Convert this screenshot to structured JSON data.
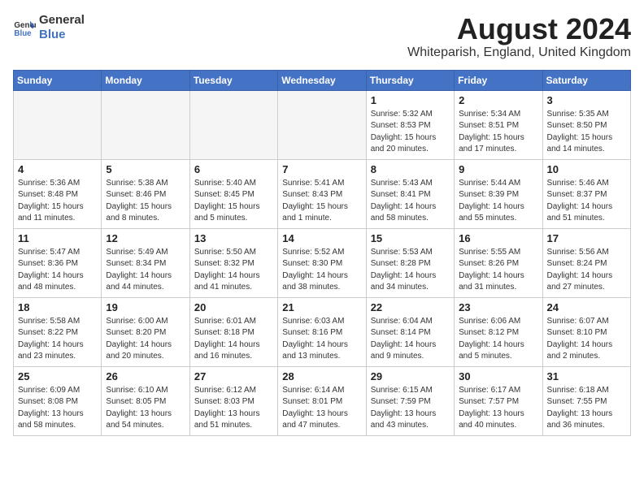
{
  "header": {
    "logo_line1": "General",
    "logo_line2": "Blue",
    "month_year": "August 2024",
    "location": "Whiteparish, England, United Kingdom"
  },
  "columns": [
    "Sunday",
    "Monday",
    "Tuesday",
    "Wednesday",
    "Thursday",
    "Friday",
    "Saturday"
  ],
  "weeks": [
    [
      {
        "day": "",
        "info": ""
      },
      {
        "day": "",
        "info": ""
      },
      {
        "day": "",
        "info": ""
      },
      {
        "day": "",
        "info": ""
      },
      {
        "day": "1",
        "info": "Sunrise: 5:32 AM\nSunset: 8:53 PM\nDaylight: 15 hours\nand 20 minutes."
      },
      {
        "day": "2",
        "info": "Sunrise: 5:34 AM\nSunset: 8:51 PM\nDaylight: 15 hours\nand 17 minutes."
      },
      {
        "day": "3",
        "info": "Sunrise: 5:35 AM\nSunset: 8:50 PM\nDaylight: 15 hours\nand 14 minutes."
      }
    ],
    [
      {
        "day": "4",
        "info": "Sunrise: 5:36 AM\nSunset: 8:48 PM\nDaylight: 15 hours\nand 11 minutes."
      },
      {
        "day": "5",
        "info": "Sunrise: 5:38 AM\nSunset: 8:46 PM\nDaylight: 15 hours\nand 8 minutes."
      },
      {
        "day": "6",
        "info": "Sunrise: 5:40 AM\nSunset: 8:45 PM\nDaylight: 15 hours\nand 5 minutes."
      },
      {
        "day": "7",
        "info": "Sunrise: 5:41 AM\nSunset: 8:43 PM\nDaylight: 15 hours\nand 1 minute."
      },
      {
        "day": "8",
        "info": "Sunrise: 5:43 AM\nSunset: 8:41 PM\nDaylight: 14 hours\nand 58 minutes."
      },
      {
        "day": "9",
        "info": "Sunrise: 5:44 AM\nSunset: 8:39 PM\nDaylight: 14 hours\nand 55 minutes."
      },
      {
        "day": "10",
        "info": "Sunrise: 5:46 AM\nSunset: 8:37 PM\nDaylight: 14 hours\nand 51 minutes."
      }
    ],
    [
      {
        "day": "11",
        "info": "Sunrise: 5:47 AM\nSunset: 8:36 PM\nDaylight: 14 hours\nand 48 minutes."
      },
      {
        "day": "12",
        "info": "Sunrise: 5:49 AM\nSunset: 8:34 PM\nDaylight: 14 hours\nand 44 minutes."
      },
      {
        "day": "13",
        "info": "Sunrise: 5:50 AM\nSunset: 8:32 PM\nDaylight: 14 hours\nand 41 minutes."
      },
      {
        "day": "14",
        "info": "Sunrise: 5:52 AM\nSunset: 8:30 PM\nDaylight: 14 hours\nand 38 minutes."
      },
      {
        "day": "15",
        "info": "Sunrise: 5:53 AM\nSunset: 8:28 PM\nDaylight: 14 hours\nand 34 minutes."
      },
      {
        "day": "16",
        "info": "Sunrise: 5:55 AM\nSunset: 8:26 PM\nDaylight: 14 hours\nand 31 minutes."
      },
      {
        "day": "17",
        "info": "Sunrise: 5:56 AM\nSunset: 8:24 PM\nDaylight: 14 hours\nand 27 minutes."
      }
    ],
    [
      {
        "day": "18",
        "info": "Sunrise: 5:58 AM\nSunset: 8:22 PM\nDaylight: 14 hours\nand 23 minutes."
      },
      {
        "day": "19",
        "info": "Sunrise: 6:00 AM\nSunset: 8:20 PM\nDaylight: 14 hours\nand 20 minutes."
      },
      {
        "day": "20",
        "info": "Sunrise: 6:01 AM\nSunset: 8:18 PM\nDaylight: 14 hours\nand 16 minutes."
      },
      {
        "day": "21",
        "info": "Sunrise: 6:03 AM\nSunset: 8:16 PM\nDaylight: 14 hours\nand 13 minutes."
      },
      {
        "day": "22",
        "info": "Sunrise: 6:04 AM\nSunset: 8:14 PM\nDaylight: 14 hours\nand 9 minutes."
      },
      {
        "day": "23",
        "info": "Sunrise: 6:06 AM\nSunset: 8:12 PM\nDaylight: 14 hours\nand 5 minutes."
      },
      {
        "day": "24",
        "info": "Sunrise: 6:07 AM\nSunset: 8:10 PM\nDaylight: 14 hours\nand 2 minutes."
      }
    ],
    [
      {
        "day": "25",
        "info": "Sunrise: 6:09 AM\nSunset: 8:08 PM\nDaylight: 13 hours\nand 58 minutes."
      },
      {
        "day": "26",
        "info": "Sunrise: 6:10 AM\nSunset: 8:05 PM\nDaylight: 13 hours\nand 54 minutes."
      },
      {
        "day": "27",
        "info": "Sunrise: 6:12 AM\nSunset: 8:03 PM\nDaylight: 13 hours\nand 51 minutes."
      },
      {
        "day": "28",
        "info": "Sunrise: 6:14 AM\nSunset: 8:01 PM\nDaylight: 13 hours\nand 47 minutes."
      },
      {
        "day": "29",
        "info": "Sunrise: 6:15 AM\nSunset: 7:59 PM\nDaylight: 13 hours\nand 43 minutes."
      },
      {
        "day": "30",
        "info": "Sunrise: 6:17 AM\nSunset: 7:57 PM\nDaylight: 13 hours\nand 40 minutes."
      },
      {
        "day": "31",
        "info": "Sunrise: 6:18 AM\nSunset: 7:55 PM\nDaylight: 13 hours\nand 36 minutes."
      }
    ]
  ]
}
